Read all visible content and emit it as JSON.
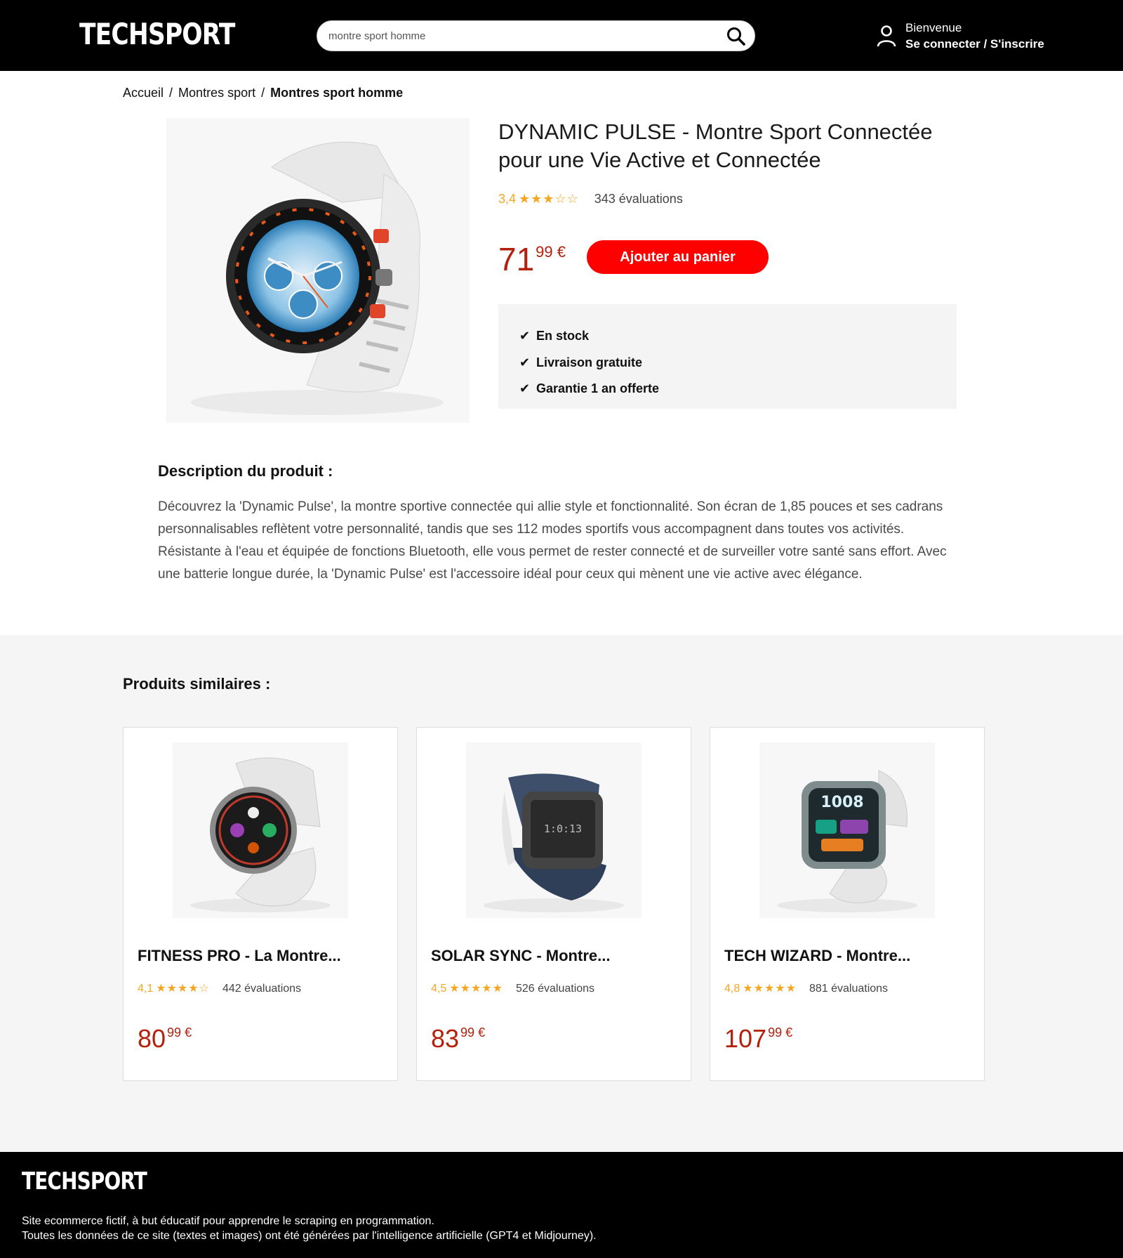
{
  "header": {
    "logo": "TECHSPORT",
    "search_value": "montre sport homme",
    "welcome": "Bienvenue",
    "login": "Se connecter / S'inscrire"
  },
  "breadcrumb": [
    "Accueil",
    "Montres sport",
    "Montres sport homme"
  ],
  "product": {
    "title": "DYNAMIC PULSE - Montre Sport Connectée pour une Vie Active et Connectée",
    "rating": "3,4",
    "rating_value": 3.4,
    "stars": "★★★☆☆",
    "reviews": "343 évaluations",
    "price_int": "71",
    "price_dec": "99 €",
    "cart_button": "Ajouter au panier",
    "features": [
      "En stock",
      "Livraison gratuite",
      "Garantie 1 an offerte"
    ],
    "feature_check": "✔"
  },
  "description": {
    "title": "Description du produit :",
    "text": "Découvrez la 'Dynamic Pulse', la montre sportive connectée qui allie style et fonctionnalité. Son écran de 1,85 pouces et ses cadrans personnalisables reflètent votre personnalité, tandis que ses 112 modes sportifs vous accompagnent dans toutes vos activités. Résistante à l'eau et équipée de fonctions Bluetooth, elle vous permet de rester connecté et de surveiller votre santé sans effort. Avec une batterie longue durée, la 'Dynamic Pulse' est l'accessoire idéal pour ceux qui mènent une vie active avec élégance."
  },
  "similar": {
    "title": "Produits similaires :",
    "items": [
      {
        "title": "FITNESS PRO - La Montre...",
        "rating": "4,1",
        "stars": "★★★★☆",
        "reviews": "442 évaluations",
        "price_int": "80",
        "price_dec": "99 €"
      },
      {
        "title": "SOLAR SYNC - Montre...",
        "rating": "4,5",
        "stars": "★★★★★",
        "reviews": "526 évaluations",
        "price_int": "83",
        "price_dec": "99 €"
      },
      {
        "title": "TECH WIZARD - Montre...",
        "rating": "4,8",
        "stars": "★★★★★",
        "reviews": "881 évaluations",
        "price_int": "107",
        "price_dec": "99 €"
      }
    ]
  },
  "watch_display": {
    "time": "1:0:13",
    "digits": "1008"
  },
  "footer": {
    "logo": "TECHSPORT",
    "line1": "Site ecommerce fictif, à but éducatif pour apprendre le scraping en programmation.",
    "line2": "Toutes les données de ce site (textes et images) ont été générées par l'intelligence artificielle (GPT4 et Midjourney)."
  },
  "colors": {
    "accent": "#ff0000",
    "price": "#b3200c",
    "star": "#f5a623",
    "header_bg": "#000000"
  },
  "icons": {
    "search": "search-icon",
    "user": "user-icon",
    "check": "check-icon"
  }
}
